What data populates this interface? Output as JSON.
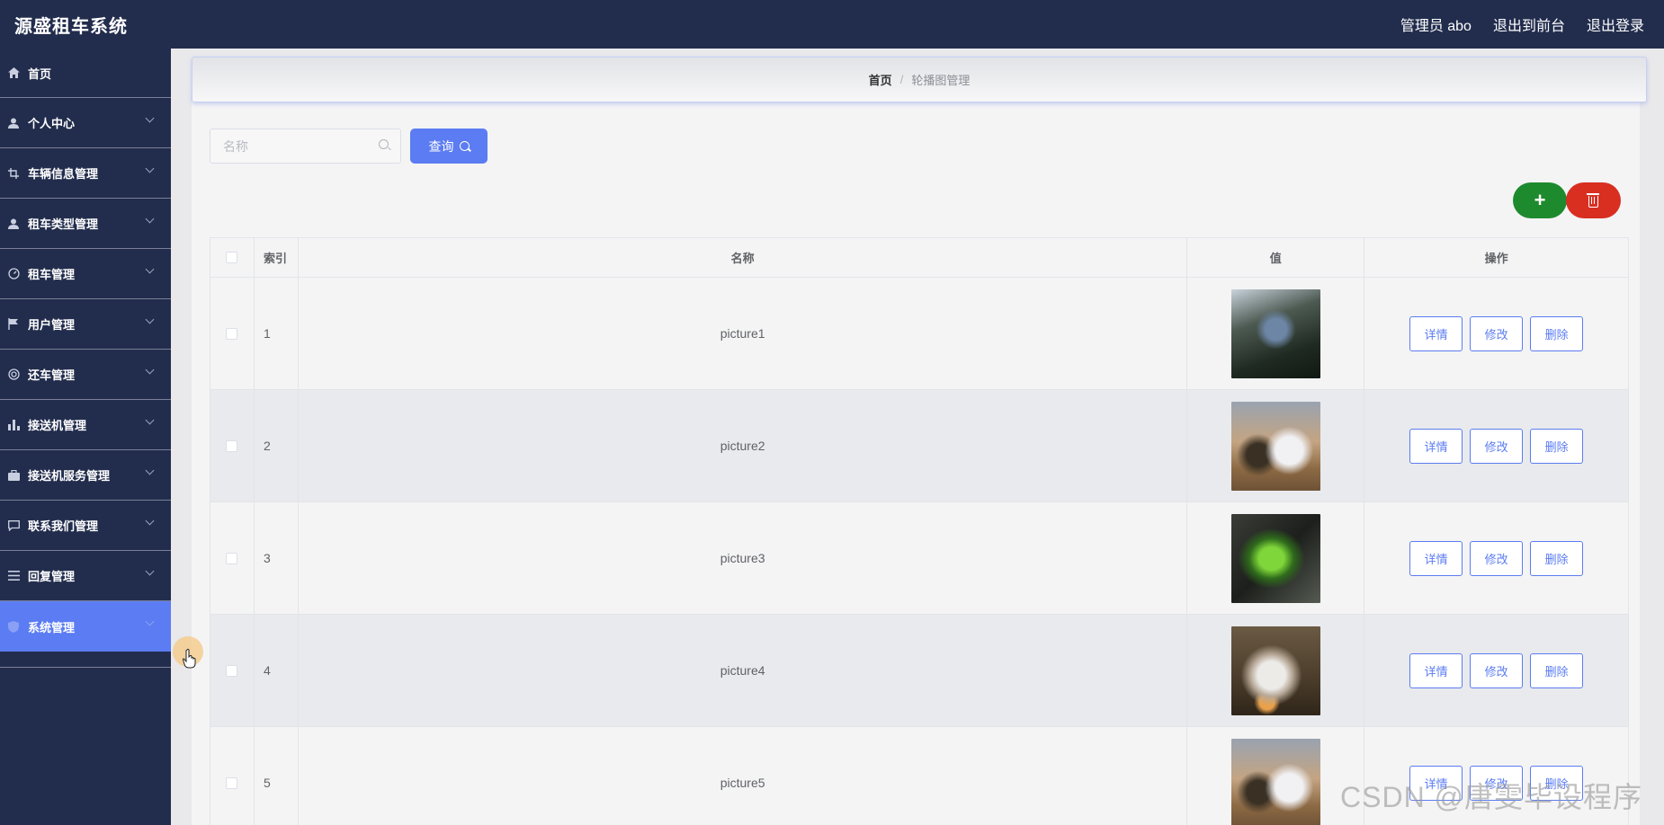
{
  "app": {
    "title": "源盛租车系统"
  },
  "header": {
    "admin": "管理员 abo",
    "to_front": "退出到前台",
    "logout": "退出登录"
  },
  "sidebar": {
    "items": [
      {
        "label": "首页",
        "icon": "home-icon"
      },
      {
        "label": "个人中心",
        "icon": "user-icon"
      },
      {
        "label": "车辆信息管理",
        "icon": "crop-icon"
      },
      {
        "label": "租车类型管理",
        "icon": "user-icon"
      },
      {
        "label": "租车管理",
        "icon": "gauge-icon"
      },
      {
        "label": "用户管理",
        "icon": "flag-icon"
      },
      {
        "label": "还车管理",
        "icon": "lifebuoy-icon"
      },
      {
        "label": "接送机管理",
        "icon": "bar-chart-icon"
      },
      {
        "label": "接送机服务管理",
        "icon": "briefcase-icon"
      },
      {
        "label": "联系我们管理",
        "icon": "message-icon"
      },
      {
        "label": "回复管理",
        "icon": "list-icon"
      },
      {
        "label": "系统管理",
        "icon": "shield-icon"
      }
    ]
  },
  "breadcrumb": {
    "home": "首页",
    "separator": "/",
    "current": "轮播图管理"
  },
  "search": {
    "placeholder": "名称",
    "value": "",
    "button_label": "查询"
  },
  "actions": {
    "add_label": "+"
  },
  "table": {
    "headers": {
      "index": "索引",
      "name": "名称",
      "value": "值",
      "ops": "操作"
    },
    "rows": [
      {
        "index": "1",
        "name": "picture1",
        "thumb": "dark-blue-sports-car"
      },
      {
        "index": "2",
        "name": "picture2",
        "thumb": "white-race-car-desert"
      },
      {
        "index": "3",
        "name": "picture3",
        "thumb": "green-sports-car"
      },
      {
        "index": "4",
        "name": "picture4",
        "thumb": "white-rally-car"
      },
      {
        "index": "5",
        "name": "picture5",
        "thumb": "white-race-car-desert"
      }
    ],
    "row_actions": {
      "detail": "详情",
      "edit": "修改",
      "delete": "删除"
    }
  },
  "watermark": "CSDN @唐雯毕设程序",
  "colors": {
    "topbar": "#222d4d",
    "primary": "#5b7cf2",
    "add": "#1e8a2e",
    "delete": "#d82f21"
  }
}
